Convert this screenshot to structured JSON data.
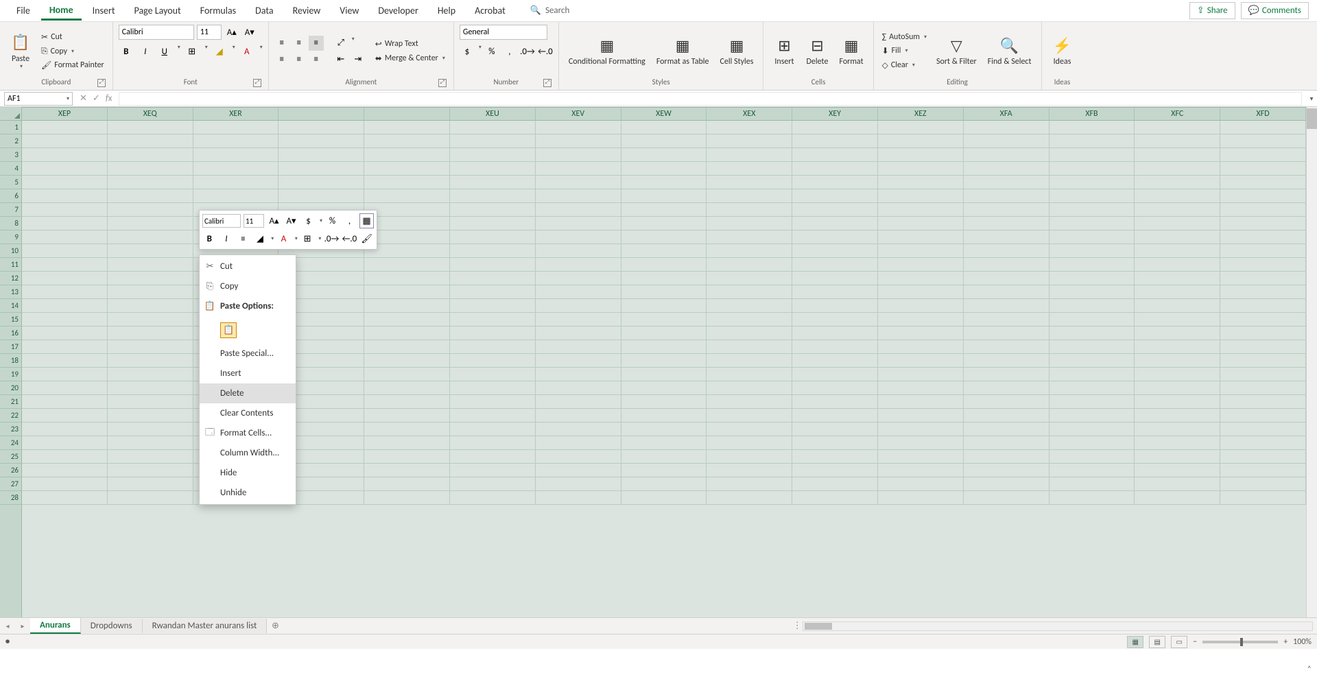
{
  "tabs": {
    "file": "File",
    "home": "Home",
    "insert": "Insert",
    "page": "Page Layout",
    "formulas": "Formulas",
    "data": "Data",
    "review": "Review",
    "view": "View",
    "developer": "Developer",
    "help": "Help",
    "acrobat": "Acrobat",
    "search": "Search"
  },
  "topButtons": {
    "share": "Share",
    "comments": "Comments"
  },
  "clipboard": {
    "paste": "Paste",
    "cut": "Cut",
    "copy": "Copy",
    "fmtPainter": "Format Painter",
    "label": "Clipboard"
  },
  "font": {
    "name": "Calibri",
    "size": "11",
    "label": "Font"
  },
  "alignment": {
    "wrap": "Wrap Text",
    "merge": "Merge & Center",
    "label": "Alignment"
  },
  "number": {
    "format": "General",
    "label": "Number"
  },
  "styles": {
    "condfmt": "Conditional Formatting",
    "fmtTable": "Format as Table",
    "cellStyles": "Cell Styles",
    "label": "Styles"
  },
  "cells": {
    "insert": "Insert",
    "delete": "Delete",
    "format": "Format",
    "label": "Cells"
  },
  "editing": {
    "autosum": "AutoSum",
    "fill": "Fill",
    "clear": "Clear",
    "sortFilter": "Sort & Filter",
    "findSelect": "Find & Select",
    "label": "Editing"
  },
  "ideas": {
    "ideas": "Ideas",
    "label": "Ideas"
  },
  "nameBox": "AF1",
  "columns": [
    "XEP",
    "XEQ",
    "XER",
    "",
    "",
    "XEU",
    "XEV",
    "XEW",
    "XEX",
    "XEY",
    "XEZ",
    "XFA",
    "XFB",
    "XFC",
    "XFD"
  ],
  "rows": [
    "1",
    "2",
    "3",
    "4",
    "5",
    "6",
    "7",
    "8",
    "9",
    "10",
    "11",
    "12",
    "13",
    "14",
    "15",
    "16",
    "17",
    "18",
    "19",
    "20",
    "21",
    "22",
    "23",
    "24",
    "25",
    "26",
    "27",
    "28"
  ],
  "miniTb": {
    "font": "Calibri",
    "size": "11"
  },
  "ctx": {
    "cut": "Cut",
    "copy": "Copy",
    "pasteOpt": "Paste Options:",
    "pasteSpecial": "Paste Special...",
    "insert": "Insert",
    "delete": "Delete",
    "clear": "Clear Contents",
    "formatCells": "Format Cells...",
    "colWidth": "Column Width...",
    "hide": "Hide",
    "unhide": "Unhide"
  },
  "sheets": {
    "s1": "Anurans",
    "s2": "Dropdowns",
    "s3": "Rwandan Master anurans list"
  },
  "status": {
    "zoom": "100%"
  }
}
